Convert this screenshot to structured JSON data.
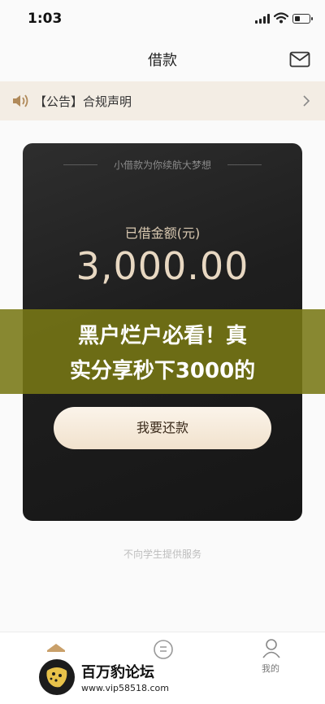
{
  "status_bar": {
    "time": "1:03"
  },
  "nav": {
    "title": "借款"
  },
  "notice": {
    "text": "【公告】合规声明"
  },
  "card": {
    "tagline": "小借款为你续航大梦想",
    "amount_label": "已借金额(元)",
    "amount": "3,000.00",
    "repay_button": "我要还款"
  },
  "overlay": {
    "line1": "黑户烂户必看！真",
    "line2": "实分享秒下3000的"
  },
  "footer_note": "不向学生提供服务",
  "tabs": [
    {
      "icon": "home-icon",
      "label": ""
    },
    {
      "icon": "loan-icon",
      "label": ""
    },
    {
      "icon": "person-icon",
      "label": "我的"
    }
  ],
  "logo": {
    "title": "百万豹论坛",
    "url": "www.vip58518.com"
  },
  "colors": {
    "accent_gold": "#e8d8c2",
    "card_bg": "#1e1e1e",
    "notice_bg": "#f3ede4",
    "overlay": "#787814"
  }
}
